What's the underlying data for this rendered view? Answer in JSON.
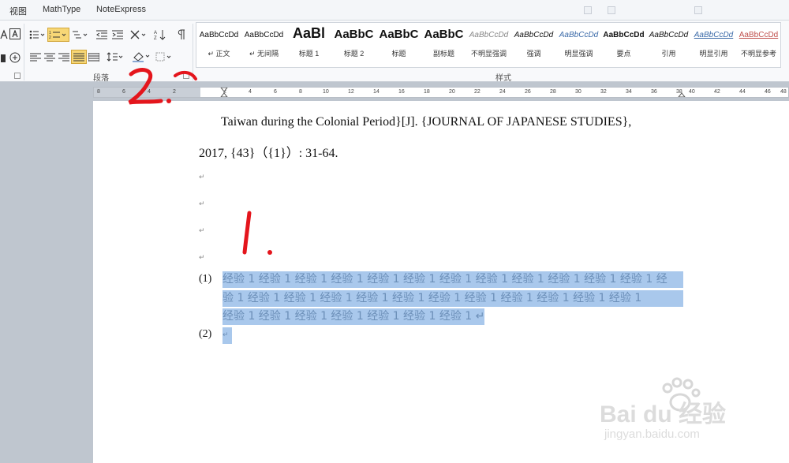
{
  "menu": {
    "tabs": [
      "视图",
      "MathType",
      "NoteExpress"
    ]
  },
  "ribbon": {
    "paragraph_group_label": "段落",
    "styles_group_label": "样式",
    "styles": [
      {
        "preview": "AaBbCcDd",
        "name": "↵ 正文"
      },
      {
        "preview": "AaBbCcDd",
        "name": "↵ 无间隔"
      },
      {
        "preview": "AaBl",
        "name": "标题 1"
      },
      {
        "preview": "AaBbC",
        "name": "标题 2"
      },
      {
        "preview": "AaBbC",
        "name": "标题"
      },
      {
        "preview": "AaBbC",
        "name": "副标题"
      },
      {
        "preview": "AaBbCcDd",
        "name": "不明显强调"
      },
      {
        "preview": "AaBbCcDd",
        "name": "强调"
      },
      {
        "preview": "AaBbCcDd",
        "name": "明显强调"
      },
      {
        "preview": "AaBbCcDd",
        "name": "要点"
      },
      {
        "preview": "AaBbCcDd",
        "name": "引用"
      },
      {
        "preview": "AaBbCcDd",
        "name": "明显引用"
      },
      {
        "preview": "AaBbCcDd",
        "name": "不明显参考"
      }
    ]
  },
  "ruler": {
    "ticks": [
      "8",
      "6",
      "4",
      "2",
      "2",
      "4",
      "6",
      "8",
      "10",
      "12",
      "14",
      "16",
      "18",
      "20",
      "22",
      "24",
      "26",
      "28",
      "30",
      "32",
      "34",
      "36",
      "38",
      "40",
      "42",
      "44",
      "46",
      "48"
    ]
  },
  "document": {
    "ref_line_1": "Taiwan during the Colonial Period}[J]. {JOURNAL OF JAPANESE STUDIES},",
    "ref_line_2": "2017, {43}（{1}）: 31-64.",
    "paragraph_mark": "↵",
    "list": [
      {
        "number": "(1)",
        "lines": [
          "经验 1 经验 1 经验 1 经验 1 经验 1 经验 1 经验 1 经验 1 经验 1 经验 1 经验 1 经验 1 经",
          "验 1 经验 1 经验 1 经验 1 经验 1 经验 1 经验 1 经验 1 经验 1 经验 1 经验 1 经验 1",
          "经验 1 经验 1 经验 1 经验 1 经验 1 经验 1 经验 1 ↵"
        ]
      },
      {
        "number": "(2)",
        "lines": [
          "↵"
        ]
      }
    ]
  },
  "annotations": {
    "mark_1": "1.",
    "mark_2": "2."
  },
  "watermark": {
    "brand": "Bai du 经验",
    "url": "jingyan.baidu.com"
  },
  "colors": {
    "selection": "#a9c8ec",
    "annotation_red": "#e4151c",
    "active_button": "#f7d776"
  }
}
